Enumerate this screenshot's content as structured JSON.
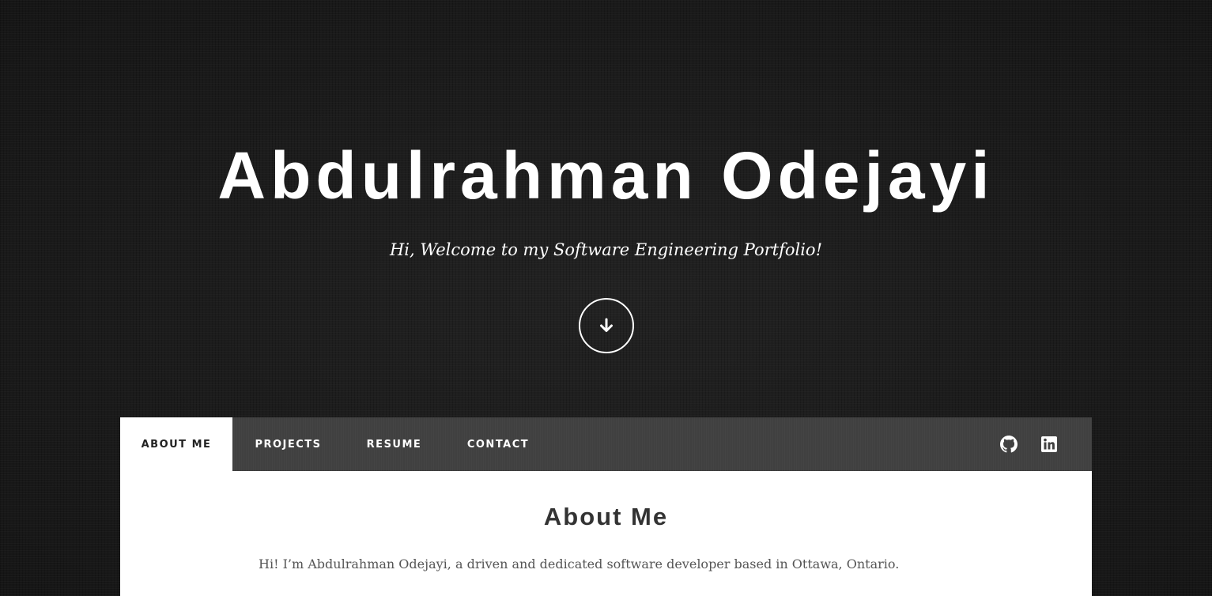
{
  "hero": {
    "title": "Abdulrahman Odejayi",
    "subtitle": "Hi, Welcome to my Software Engineering Portfolio!",
    "scroll_icon": "arrow-down-icon"
  },
  "nav": {
    "tabs": [
      {
        "label": "ABOUT ME",
        "active": true
      },
      {
        "label": "PROJECTS",
        "active": false
      },
      {
        "label": "RESUME",
        "active": false
      },
      {
        "label": "CONTACT",
        "active": false
      }
    ],
    "social_icons": [
      "github-icon",
      "linkedin-icon"
    ]
  },
  "about": {
    "title": "About Me",
    "intro": "Hi! I’m Abdulrahman Odejayi, a driven and dedicated software developer based in Ottawa, Ontario."
  },
  "colors": {
    "background": "#1b1b1b",
    "navbar": "#404040",
    "panel": "#ffffff",
    "hero_text": "#ffffff",
    "heading_text": "#333333",
    "body_text": "#555555"
  }
}
